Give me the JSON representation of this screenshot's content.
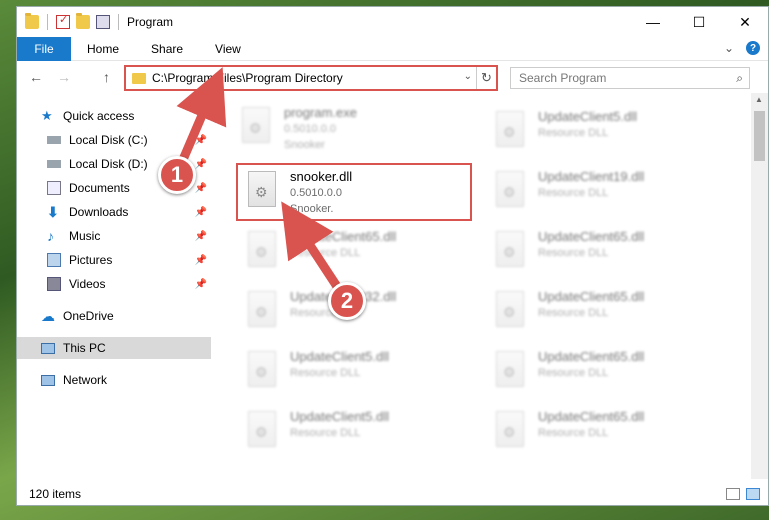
{
  "window": {
    "title": "Program",
    "buttons": {
      "minimize": "—",
      "maximize": "☐",
      "close": "✕"
    }
  },
  "ribbon": {
    "tabs": [
      "File",
      "Home",
      "Share",
      "View"
    ],
    "expand": "⌄",
    "help": "?"
  },
  "address": {
    "path": "C:\\Program Files\\Program Directory",
    "chevron": "⌄",
    "refresh": "↻"
  },
  "search": {
    "placeholder": "Search Program",
    "icon": "⌕"
  },
  "nav": {
    "back": "←",
    "forward": "→",
    "up": "↑"
  },
  "sidebar": {
    "items": [
      {
        "label": "Quick access",
        "icon": "star-icon"
      },
      {
        "label": "Local Disk (C:)",
        "icon": "drive-icon"
      },
      {
        "label": "Local Disk (D:)",
        "icon": "drive-icon"
      },
      {
        "label": "Documents",
        "icon": "documents-icon"
      },
      {
        "label": "Downloads",
        "icon": "download-icon"
      },
      {
        "label": "Music",
        "icon": "music-icon"
      },
      {
        "label": "Pictures",
        "icon": "pictures-icon"
      },
      {
        "label": "Videos",
        "icon": "videos-icon"
      },
      {
        "label": "OneDrive",
        "icon": "cloud-icon"
      },
      {
        "label": "This PC",
        "icon": "computer-icon"
      },
      {
        "label": "Network",
        "icon": "network-icon"
      }
    ]
  },
  "files": {
    "left": [
      {
        "name": "program.exe",
        "version": "0.5010.0.0",
        "desc": "Snooker"
      },
      {
        "name": "snooker.dll",
        "version": "0.5010.0.0",
        "desc": "Snooker."
      },
      {
        "name": "UpdateClient65.dll",
        "version": "",
        "desc": "Resource DLL"
      },
      {
        "name": "UpdateClient32.dll",
        "version": "",
        "desc": "Resource DLL"
      },
      {
        "name": "UpdateClient5.dll",
        "version": "",
        "desc": "Resource DLL"
      },
      {
        "name": "UpdateClient5.dll",
        "version": "",
        "desc": "Resource DLL"
      }
    ],
    "right": [
      {
        "name": "UpdateClient5.dll",
        "desc": "Resource DLL"
      },
      {
        "name": "UpdateClient19.dll",
        "desc": "Resource DLL"
      },
      {
        "name": "UpdateClient65.dll",
        "desc": "Resource DLL"
      },
      {
        "name": "UpdateClient65.dll",
        "desc": "Resource DLL"
      },
      {
        "name": "UpdateClient65.dll",
        "desc": "Resource DLL"
      },
      {
        "name": "UpdateClient65.dll",
        "desc": "Resource DLL"
      }
    ]
  },
  "status": {
    "count": "120 items"
  },
  "annotations": {
    "badge1": "1",
    "badge2": "2",
    "color": "#d9534f"
  }
}
